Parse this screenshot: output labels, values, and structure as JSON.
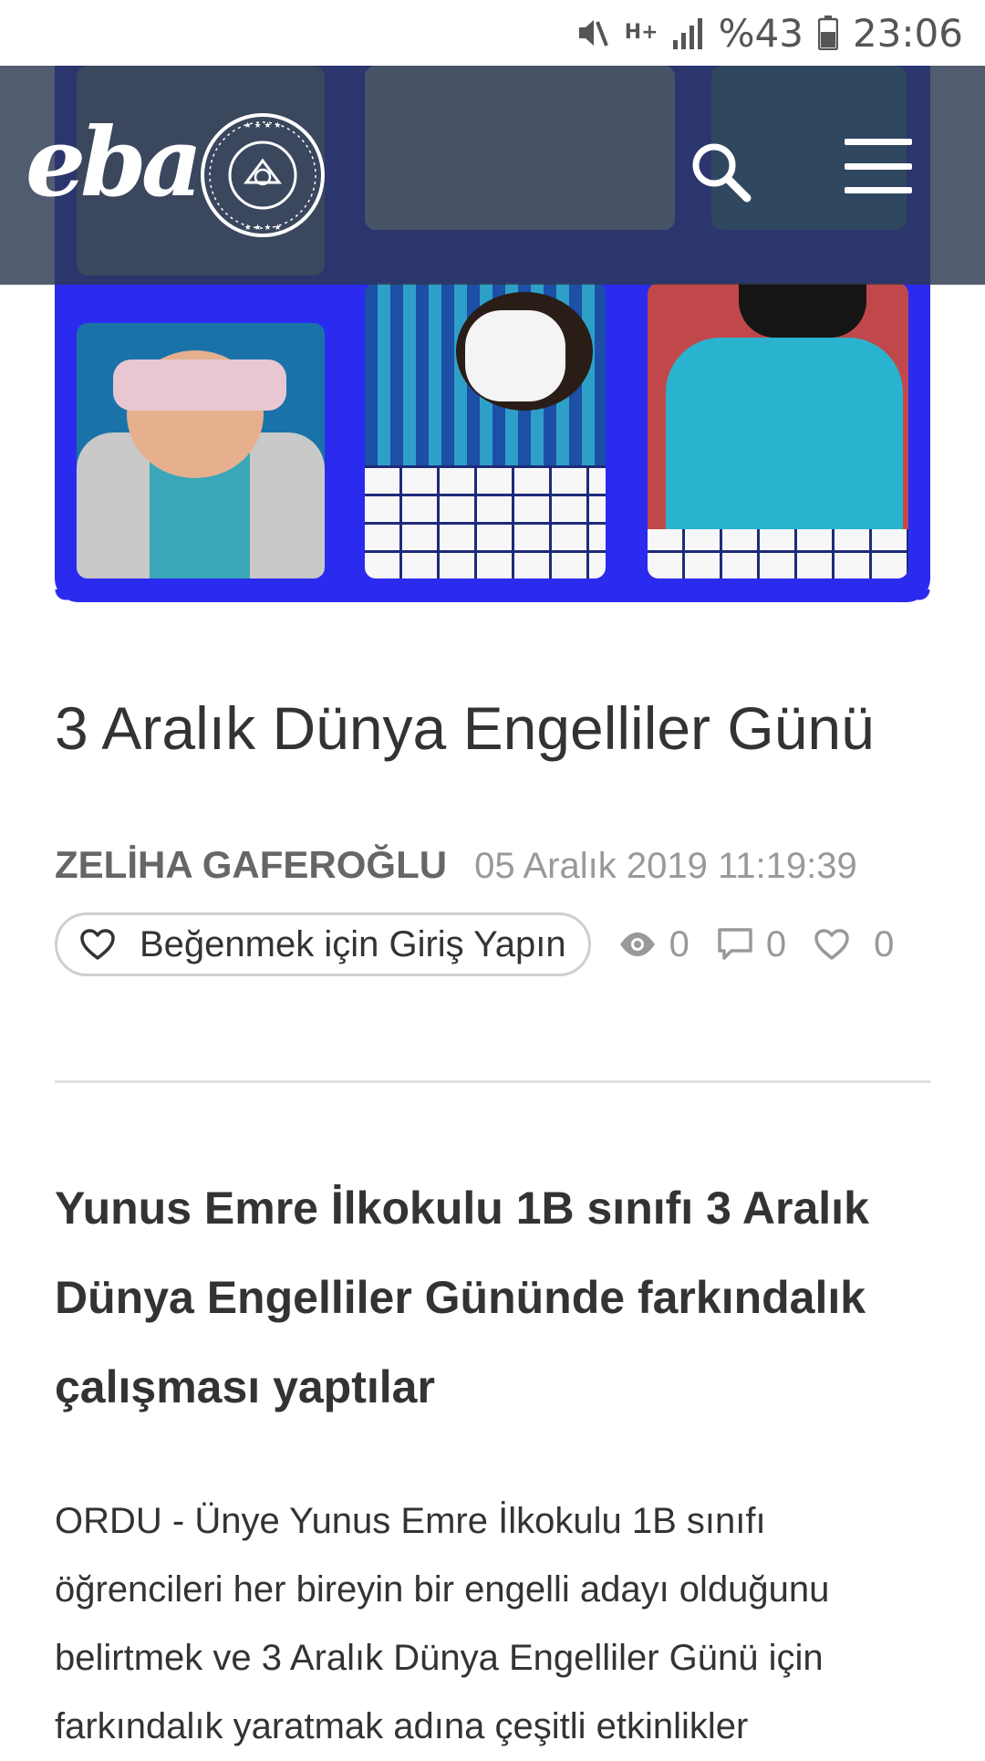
{
  "status_bar": {
    "battery": "%43",
    "time": "23:06",
    "network": "H+"
  },
  "header": {
    "logo": "eba",
    "seal_text": "TÜRKİYE CUMHURİYETİ MİLLİ EĞİTİM BAKANLIĞI",
    "icons": [
      "search-icon",
      "hamburger-menu-icon"
    ]
  },
  "article": {
    "title": "3 Aralık Dünya Engelliler Günü",
    "author": "ZELİHA GAFEROĞLU",
    "date": "05 Aralık 2019 11:19:39",
    "like_button_label": "Beğenmek için Giriş Yapın",
    "stats": {
      "views": "0",
      "comments": "0",
      "likes": "0"
    },
    "subtitle": "Yunus Emre İlkokulu 1B sınıfı 3 Aralık Dünya Engelliler Gününde farkındalık çalışması yaptılar",
    "body": "ORDU - Ünye Yunus Emre İlkokulu 1B sınıfı öğrencileri her bireyin bir engelli adayı olduğunu belirtmek ve 3 Aralık Dünya Engelliler Günü için farkındalık yaratmak adına çeşitli etkinlikler"
  },
  "colors": {
    "header_bg": "#2c3850",
    "collage_frame": "#2b2bf0",
    "text_primary": "#333333",
    "text_secondary": "#999999"
  }
}
